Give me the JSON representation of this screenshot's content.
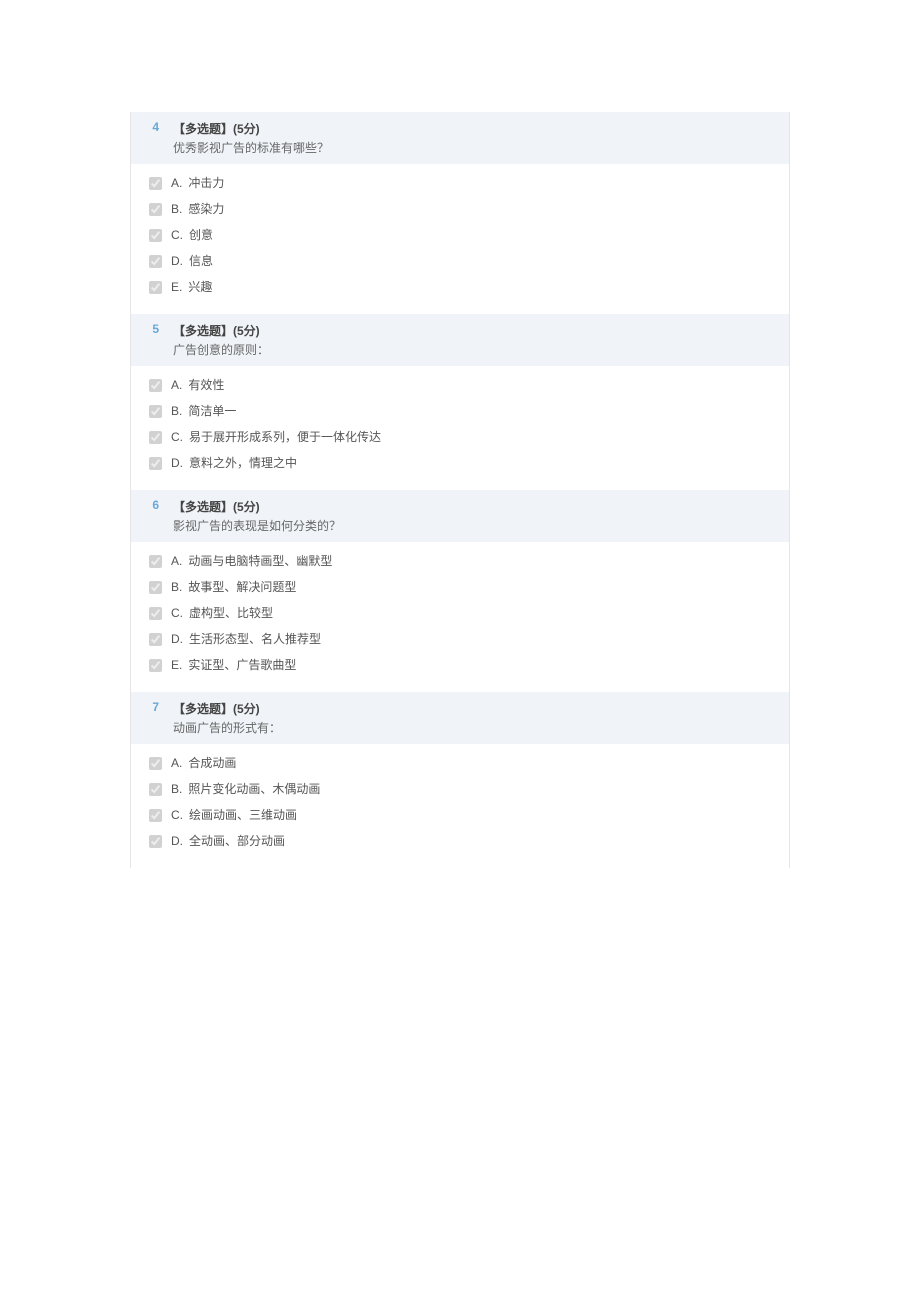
{
  "questions": [
    {
      "num": "4",
      "type": "【多选题】(5分)",
      "prompt": "优秀影视广告的标准有哪些？",
      "options": [
        {
          "letter": "A.",
          "text": "冲击力"
        },
        {
          "letter": "B.",
          "text": "感染力"
        },
        {
          "letter": "C.",
          "text": "创意"
        },
        {
          "letter": "D.",
          "text": "信息"
        },
        {
          "letter": "E.",
          "text": "兴趣"
        }
      ]
    },
    {
      "num": "5",
      "type": "【多选题】(5分)",
      "prompt": "广告创意的原则：",
      "options": [
        {
          "letter": "A.",
          "text": "有效性"
        },
        {
          "letter": "B.",
          "text": "简洁单一"
        },
        {
          "letter": "C.",
          "text": "易于展开形成系列，便于一体化传达"
        },
        {
          "letter": "D.",
          "text": "意料之外，情理之中"
        }
      ]
    },
    {
      "num": "6",
      "type": "【多选题】(5分)",
      "prompt": "影视广告的表现是如何分类的？",
      "options": [
        {
          "letter": "A.",
          "text": "动画与电脑特画型、幽默型"
        },
        {
          "letter": "B.",
          "text": "故事型、解决问题型"
        },
        {
          "letter": "C.",
          "text": "虚构型、比较型"
        },
        {
          "letter": "D.",
          "text": "生活形态型、名人推荐型"
        },
        {
          "letter": "E.",
          "text": "实证型、广告歌曲型"
        }
      ]
    },
    {
      "num": "7",
      "type": "【多选题】(5分)",
      "prompt": "动画广告的形式有：",
      "options": [
        {
          "letter": "A.",
          "text": "合成动画"
        },
        {
          "letter": "B.",
          "text": "照片变化动画、木偶动画"
        },
        {
          "letter": "C.",
          "text": "绘画动画、三维动画"
        },
        {
          "letter": "D.",
          "text": "全动画、部分动画"
        }
      ]
    }
  ]
}
